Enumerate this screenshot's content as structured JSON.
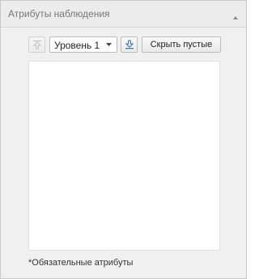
{
  "panel": {
    "title": "Атрибуты наблюдения",
    "collapse_icon": "collapse-up-icon"
  },
  "toolbar": {
    "move_up_icon": "move-up-icon",
    "level": {
      "selected": "Уровень 1",
      "dropdown_icon": "chevron-down-icon"
    },
    "move_down_icon": "move-down-icon",
    "hide_empty_label": "Скрыть пустые"
  },
  "attributes": {
    "items": []
  },
  "footnote": "*Обязательные атрибуты"
}
